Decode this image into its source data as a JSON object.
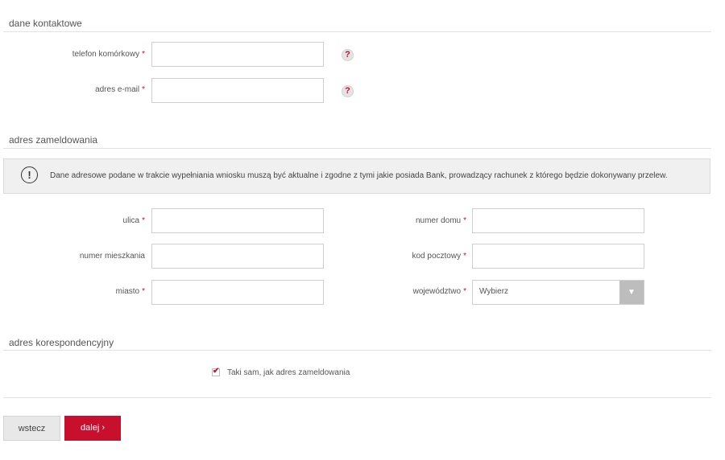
{
  "sections": {
    "contact": {
      "title": "dane kontaktowe"
    },
    "registered_address": {
      "title": "adres zameldowania"
    },
    "correspondence_address": {
      "title": "adres korespondencyjny"
    }
  },
  "required_marker": "*",
  "contact": {
    "phone": {
      "label": "telefon komórkowy",
      "value": ""
    },
    "email": {
      "label": "adres e-mail",
      "value": ""
    },
    "help_icon": {
      "glyph": "?",
      "icon": "question-mark-icon"
    }
  },
  "notice": {
    "icon": "exclamation-circle-icon",
    "icon_glyph": "!",
    "text": "Dane adresowe podane w trakcie wypełniania wniosku muszą być aktualne i zgodne z tymi jakie posiada Bank, prowadzący rachunek z którego będzie dokonywany przelew."
  },
  "address": {
    "street": {
      "label": "ulica",
      "value": ""
    },
    "house_number": {
      "label": "numer domu",
      "value": ""
    },
    "apartment_number": {
      "label": "numer mieszkania",
      "value": ""
    },
    "postal_code": {
      "label": "kod pocztowy",
      "value": ""
    },
    "city": {
      "label": "miasto",
      "value": ""
    },
    "voivodeship": {
      "label": "województwo",
      "selected": "Wybierz",
      "arrow_glyph": "▼"
    }
  },
  "correspondence": {
    "same_as_registered_label": "Taki sam, jak adres zameldowania",
    "checked": true,
    "check_glyph": "✔"
  },
  "buttons": {
    "back_label": "wstecz",
    "next_label": "dalej ›"
  },
  "colors": {
    "accent": "#c8102e",
    "button_secondary": "#e8e8e8",
    "notice_background": "#f0f0f0",
    "select_arrow_background": "#bdbdbd"
  }
}
